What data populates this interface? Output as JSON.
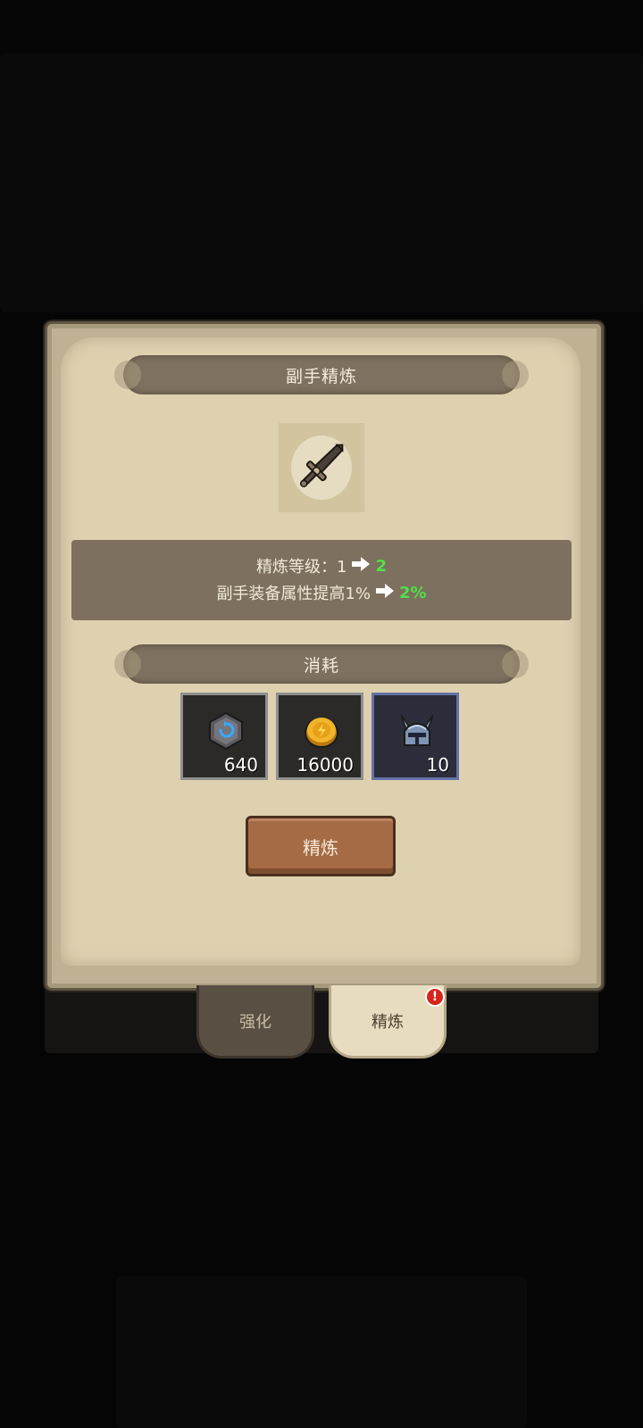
{
  "dialog": {
    "title": "副手精炼",
    "item_icon": "sword-icon"
  },
  "info": {
    "level_label": "精炼等级：1",
    "level_next": "2",
    "bonus_label": "副手装备属性提高1%",
    "bonus_next": "2%"
  },
  "cost": {
    "title": "消耗",
    "items": [
      {
        "icon": "refine-stone-icon",
        "count": "640"
      },
      {
        "icon": "gold-coin-icon",
        "count": "16000"
      },
      {
        "icon": "helmet-icon",
        "count": "10"
      }
    ]
  },
  "action": {
    "refine_label": "精炼"
  },
  "tabs": {
    "enhance_label": "强化",
    "refine_label": "精炼",
    "badge": "!"
  }
}
